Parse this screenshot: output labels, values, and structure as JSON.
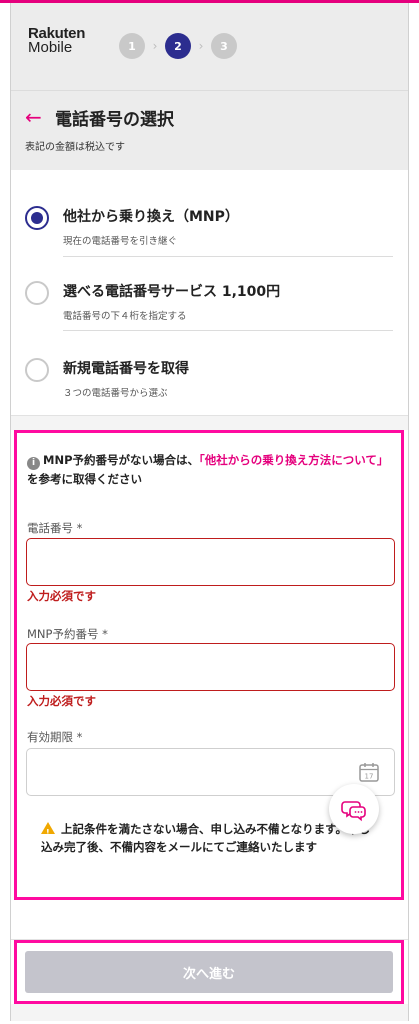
{
  "brand": {
    "line1": "Rakuten",
    "line2": "Mobile"
  },
  "steps": [
    {
      "label": "1",
      "active": false
    },
    {
      "label": "2",
      "active": true
    },
    {
      "label": "3",
      "active": false
    }
  ],
  "header": {
    "title": "電話番号の選択",
    "tax_note": "表記の金額は税込です"
  },
  "options": [
    {
      "title": "他社から乗り換え（MNP）",
      "subtitle": "現在の電話番号を引き継ぐ",
      "selected": true
    },
    {
      "title": "選べる電話番号サービス 1,100円",
      "subtitle": "電話番号の下４桁を指定する",
      "selected": false
    },
    {
      "title": "新規電話番号を取得",
      "subtitle": "３つの電話番号から選ぶ",
      "selected": false
    }
  ],
  "form": {
    "info_prefix": "MNP予約番号がない場合は、",
    "info_link": "「他社からの乗り換え方法について」",
    "info_suffix": "を参考に取得ください",
    "phone": {
      "label": "電話番号 *",
      "value": "",
      "error": "入力必須です"
    },
    "mnp": {
      "label": "MNP予約番号 *",
      "value": "",
      "error": "入力必須です"
    },
    "expiry": {
      "label": "有効期限 *",
      "value": ""
    },
    "warning": "上記条件を満たさない場合、申し込み不備となります。申し込み完了後、不備内容をメールにてご連絡いたします"
  },
  "next_button": "次へ進む",
  "colors": {
    "accent": "#e5007d",
    "primary": "#2c2d8f",
    "error": "#bf1d1d",
    "highlight": "#ff0aa0"
  },
  "icons": [
    "arrow-left-icon",
    "calendar-icon",
    "chat-icon",
    "info-icon",
    "warning-icon"
  ]
}
